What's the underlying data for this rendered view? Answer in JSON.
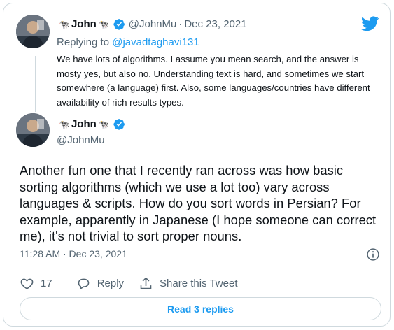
{
  "colors": {
    "brand_blue": "#1d9bf0",
    "text_primary": "#0f1419",
    "text_secondary": "#536471",
    "border": "#cfd9de"
  },
  "reply_tweet": {
    "emoji_left": "🐄",
    "display_name": "John",
    "emoji_right": "🐄",
    "handle": "@JohnMu",
    "separator": "·",
    "date": "Dec 23, 2021",
    "replying_prefix": "Replying to",
    "replying_to": "@javadtaghavi131",
    "text": "We have lots of algorithms. I assume you mean search, and the answer is mosty yes, but also no. Understanding text is hard, and sometimes we start somewhere (a language) first. Also, some languages/countries have different availability of rich results types."
  },
  "main_tweet": {
    "emoji_left": "🐄",
    "display_name": "John",
    "emoji_right": "🐄",
    "handle": "@JohnMu",
    "text": "Another fun one that I recently ran across was how basic sorting algorithms (which we use a lot too) vary across languages & scripts. How do you sort words in Persian? For example, apparently in Japanese (I hope someone can correct me), it's not trivial to sort proper nouns.",
    "timestamp": "11:28 AM · Dec 23, 2021",
    "like_count": "17",
    "reply_label": "Reply",
    "share_label": "Share this Tweet",
    "read_replies_label": "Read 3 replies"
  },
  "icons": {
    "logo": "twitter-bird-icon",
    "verified": "verified-badge-icon",
    "info": "info-icon",
    "like": "heart-icon",
    "reply": "speech-bubble-icon",
    "share": "share-upload-icon"
  }
}
